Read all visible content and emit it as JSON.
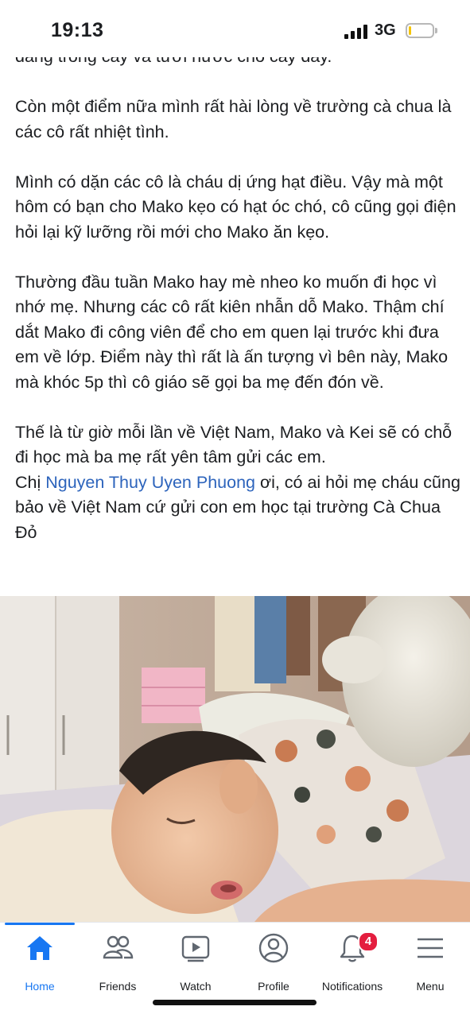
{
  "status_bar": {
    "time": "19:13",
    "network": "3G",
    "battery_level": 0.1,
    "battery_color": "#f5c400"
  },
  "post": {
    "paragraphs": [
      {
        "text": "đang trồng cây và tưới nước cho cây đấy."
      },
      {
        "text": "Còn một điểm nữa mình rất hài lòng về trường cà chua là các cô rất nhiệt tình."
      },
      {
        "text": "Mình có dặn các cô là cháu dị ứng hạt điều. Vậy mà một hôm có bạn cho Mako kẹo có hạt óc chó, cô cũng gọi điện hỏi lại kỹ lưỡng rồi mới cho Mako ăn kẹo."
      },
      {
        "text": "Thường đầu tuần Mako hay mè nheo ko muốn đi học vì nhớ mẹ. Nhưng các cô rất kiên nhẫn dỗ Mako. Thậm chí dắt Mako đi công viên để cho em quen lại trước khi đưa em về lớp. Điểm này thì rất là ấn tượng vì bên này, Mako mà khóc 5p thì cô giáo sẽ gọi ba mẹ đến đón về."
      },
      {
        "text": "Thế là từ giờ mỗi lần về Việt Nam, Mako và Kei sẽ có chỗ đi học mà ba mẹ rất yên tâm gửi các em."
      }
    ],
    "mention_prefix": "Chị ",
    "mention_name": "Nguyen Thuy Uyen Phuong",
    "mention_suffix": " ơi, có ai hỏi mẹ cháu cũng bảo về Việt Nam cứ gửi con em học tại trường Cà Chua Đỏ",
    "mention_color": "#2d64bc"
  },
  "tab_bar": {
    "active_color": "#1877f2",
    "tabs": [
      {
        "label": "Home",
        "icon": "home-icon",
        "active": true
      },
      {
        "label": "Friends",
        "icon": "friends-icon",
        "active": false
      },
      {
        "label": "Watch",
        "icon": "watch-icon",
        "active": false
      },
      {
        "label": "Profile",
        "icon": "profile-icon",
        "active": false
      },
      {
        "label": "Notifications",
        "icon": "bell-icon",
        "active": false,
        "badge": "4"
      },
      {
        "label": "Menu",
        "icon": "menu-icon",
        "active": false
      }
    ]
  }
}
